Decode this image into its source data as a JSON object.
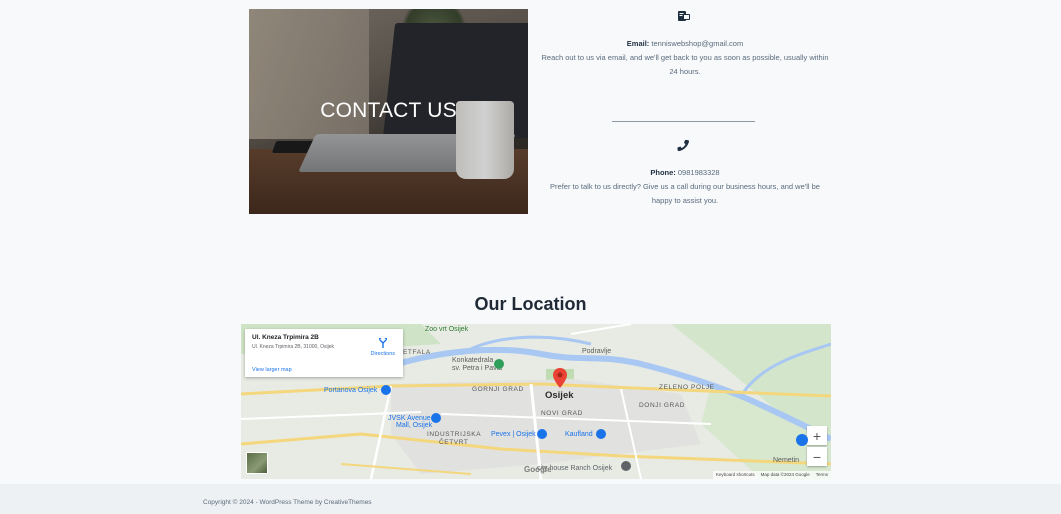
{
  "hero": {
    "title": "CONTACT US"
  },
  "email": {
    "label": "Email:",
    "value": "tenniswebshop@gmail.com",
    "text": "Reach out to us via email, and we'll get back to you as soon as possible, usually within 24 hours.",
    "icon": "email-icon"
  },
  "phone": {
    "label": "Phone:",
    "value": "0981983328",
    "text": "Prefer to talk to us directly? Give us a call during our business hours, and we'll be happy to assist you.",
    "icon": "phone-icon"
  },
  "location": {
    "heading": "Our Location"
  },
  "map": {
    "card": {
      "address": "Ul. Kneza Trpimira 2B",
      "address_full": "Ul. Kneza Trpimira 2B, 31000, Osijek",
      "directions": "Directions",
      "larger_map": "View larger map"
    },
    "labels": {
      "osijek": "Osijek",
      "tvrdja": "ETFALA",
      "cathedral": "Konkatedrala",
      "cathedral2": "sv. Petra i Pavla",
      "gornji": "GORNJI GRAD",
      "donji": "DONJI GRAD",
      "novi": "NOVI GRAD",
      "zeleno": "ZELENO POLJE",
      "industrijska": "INDUSTRIJSKA",
      "cetvrt": "ČETVRT",
      "podravlje": "Podravlje",
      "portanova": "Portanova Osijek",
      "jvsk": "JVSK Avenue",
      "mall": "Mall, Osijek",
      "pevex": "Pevex | Osijek",
      "kaufland": "Kaufland",
      "ranch": "city house Ranch Osijek",
      "nemetin": "Nemetin",
      "zoo": "Zoo vrt Osijek",
      "google": "Google"
    },
    "zoom_in": "+",
    "zoom_out": "−",
    "footer": {
      "shortcuts": "Keyboard shortcuts",
      "mapdata": "Map data ©2024 Google",
      "terms": "Terms"
    }
  },
  "footer": {
    "copyright": "Copyright © 2024 - WordPress Theme by CreativeThemes"
  }
}
